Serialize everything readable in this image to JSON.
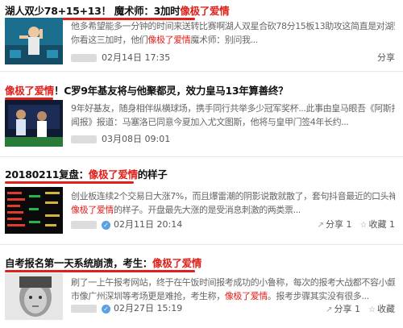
{
  "articles": [
    {
      "title": [
        {
          "t": "湖人双少78+15+13！ 魔术师：3加时",
          "hl": false
        },
        {
          "t": "像极了爱情",
          "hl": true
        }
      ],
      "snippet_lines": [
        [
          {
            "t": "他多希望能多一分钟的时间来送转比赛啊湖人双星合砍78分15板13助攻这简直是对湖蜜的凌迟啊湖蜜：",
            "hl": false
          }
        ],
        [
          {
            "t": "你看这三加时，他们",
            "hl": false
          },
          {
            "t": "像极了爱情",
            "hl": true
          },
          {
            "t": "魔术师：别问我...",
            "hl": false
          }
        ]
      ],
      "date": "02月14日 17:35",
      "verified": false,
      "actions": [
        {
          "label": "分享",
          "icon": ""
        }
      ]
    },
    {
      "title": [
        {
          "t": "像极了爱情",
          "hl": true
        },
        {
          "t": "！C罗9年基友将与他聚都灵，效力皇马13年算善终？",
          "hl": false
        }
      ],
      "snippet_lines": [
        [
          {
            "t": "9年好基友，随身相伴纵横球场，携手同行共举多少冠军奖杯...此事由皇马眼吾《阿斯报》转载意媒《新",
            "hl": false
          }
        ],
        [
          {
            "t": "闻报》报道：马塞洛已同意今夏加入尤文图斯，他将与皇甲门签4年长约...",
            "hl": false
          }
        ]
      ],
      "date": "03月08日 09:01",
      "verified": false,
      "actions": []
    },
    {
      "title": [
        {
          "t": "20180211复盘：",
          "hl": false
        },
        {
          "t": "像极了爱情",
          "hl": true
        },
        {
          "t": "的样子",
          "hl": false
        }
      ],
      "snippet_lines": [
        [
          {
            "t": "创业板连续2个交易日大涨7%，而且爆雷潮的阴影说散就散了，套句抖音最近的口头禅，这行情真的是",
            "hl": false
          }
        ],
        [
          {
            "t": "像极了爱情",
            "hl": true
          },
          {
            "t": "的样子。开盘最先大涨的是受消息刺激的两类票...",
            "hl": false
          }
        ]
      ],
      "date": "02月11日 20:14",
      "verified": true,
      "actions": [
        {
          "label": "分享 1",
          "icon": "↗"
        },
        {
          "label": "收藏 1",
          "icon": "☆"
        }
      ]
    },
    {
      "title": [
        {
          "t": "自考报名第一天系统崩溃，考生：",
          "hl": false
        },
        {
          "t": "像极了爱情",
          "hl": true
        }
      ],
      "snippet_lines": [
        [
          {
            "t": "刷了一上午报考网站，终于在午饭时间报考成功的小鲁称，每次的报考大战都不容小觑，尤其是一线城",
            "hl": false
          }
        ],
        [
          {
            "t": "市",
            "hl": false
          },
          {
            "t": "像广州深圳等考场更是难抢，考生称，",
            "hl": false
          },
          {
            "t": "像极了爱情",
            "hl": true
          },
          {
            "t": "。报考步骤其实没有很多...",
            "hl": false
          }
        ]
      ],
      "date": "02月27日 15:19",
      "verified": true,
      "actions": [
        {
          "label": "分享 1",
          "icon": "↗"
        },
        {
          "label": "收藏",
          "icon": "☆"
        }
      ]
    }
  ]
}
